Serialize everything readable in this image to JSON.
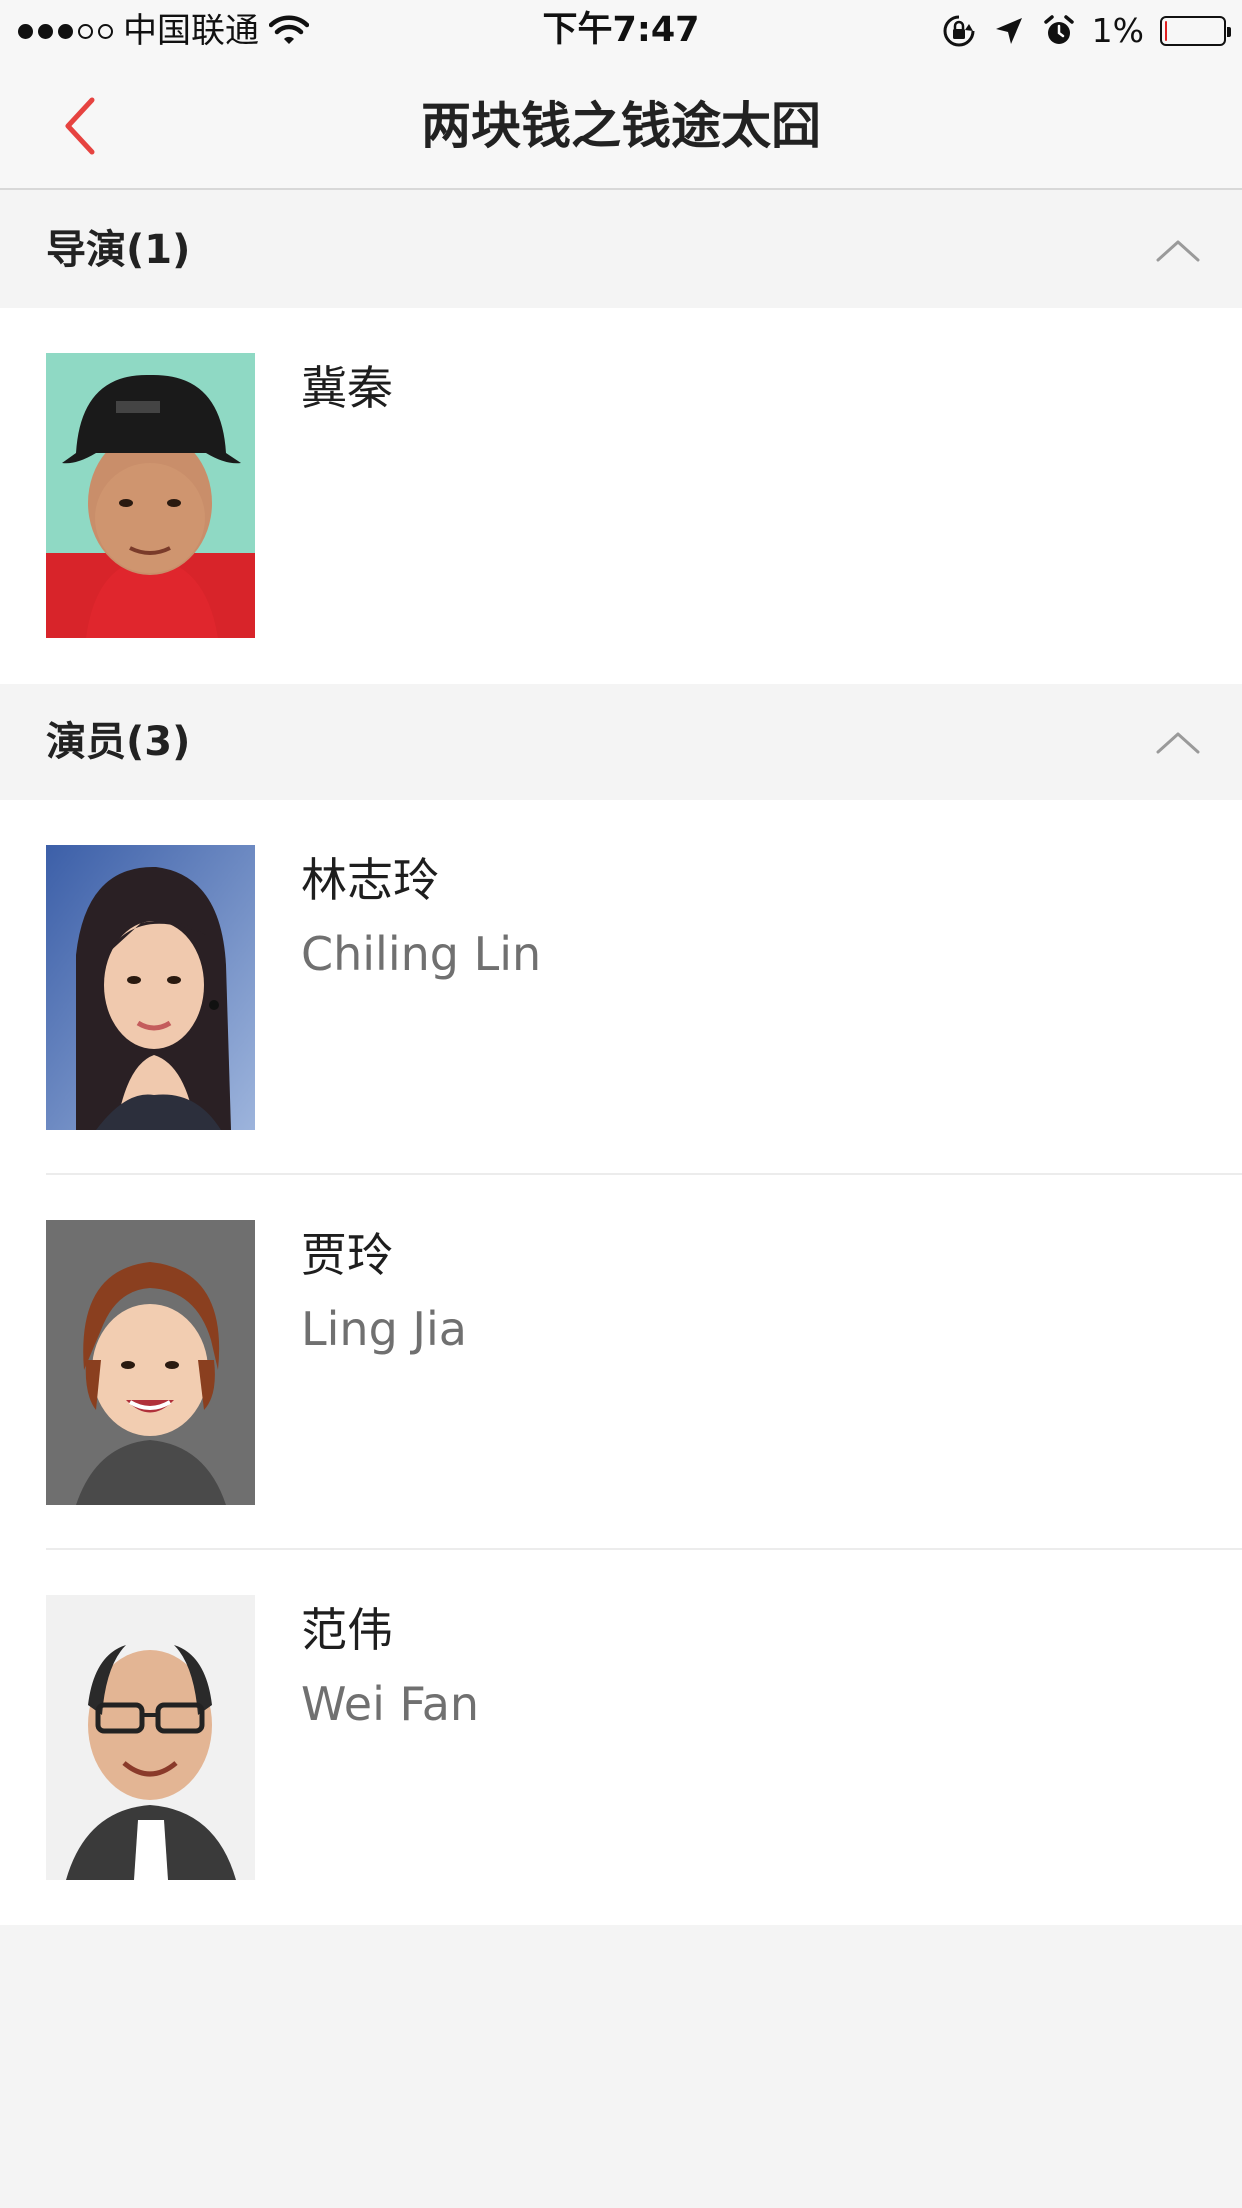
{
  "status_bar": {
    "carrier": "中国联通",
    "time": "下午7:47",
    "battery_percent": "1%",
    "battery_level": 0.01,
    "icons": [
      "signal-icon",
      "wifi-icon",
      "rotation-lock-icon",
      "location-arrow-icon",
      "alarm-icon",
      "battery-icon"
    ]
  },
  "nav": {
    "title": "两块钱之钱途太囧",
    "back_icon": "chevron-left-icon",
    "accent_color": "#e64340"
  },
  "sections": [
    {
      "title": "导演(1)",
      "expanded": true,
      "people": [
        {
          "name_cn": "冀秦",
          "name_en": ""
        }
      ]
    },
    {
      "title": "演员(3)",
      "expanded": true,
      "people": [
        {
          "name_cn": "林志玲",
          "name_en": "Chiling Lin"
        },
        {
          "name_cn": "贾玲",
          "name_en": "Ling Jia"
        },
        {
          "name_cn": "范伟",
          "name_en": "Wei Fan"
        }
      ]
    }
  ]
}
